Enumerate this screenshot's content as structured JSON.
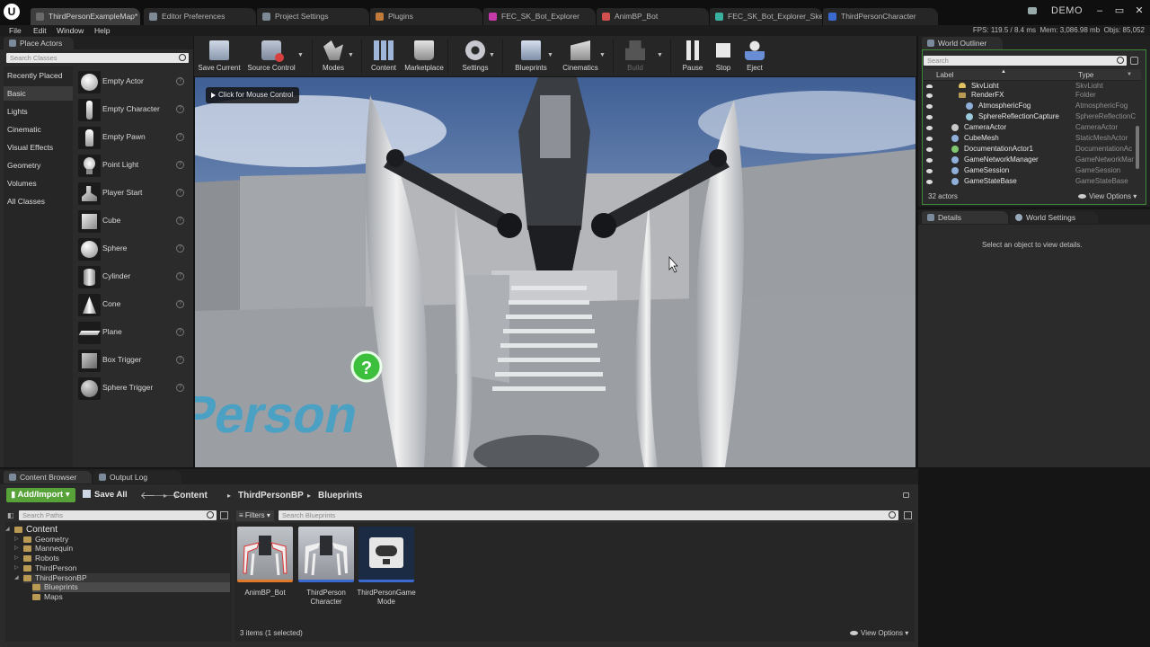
{
  "tabs": [
    {
      "label": "ThirdPersonExampleMap*",
      "active": true
    },
    {
      "label": "Editor Preferences"
    },
    {
      "label": "Project Settings"
    },
    {
      "label": "Plugins"
    },
    {
      "label": "FEC_SK_Bot_Explorer"
    },
    {
      "label": "AnimBP_Bot"
    },
    {
      "label": "FEC_SK_Bot_Explorer_Ske"
    },
    {
      "label": "ThirdPersonCharacter"
    }
  ],
  "app_badge": "DEMO",
  "menu": [
    "File",
    "Edit",
    "Window",
    "Help"
  ],
  "perf": {
    "fps_label": "FPS:",
    "fps": "119.5",
    "ms": "8.4 ms",
    "mem_label": "Mem:",
    "mem": "3,086.98 mb",
    "objs_label": "Objs:",
    "objs": "85,052"
  },
  "place_actors": {
    "tab": "Place Actors",
    "search_placeholder": "Search Classes",
    "categories": [
      "Recently Placed",
      "Basic",
      "Lights",
      "Cinematic",
      "Visual Effects",
      "Geometry",
      "Volumes",
      "All Classes"
    ],
    "selected_category": "Basic",
    "items": [
      "Empty Actor",
      "Empty Character",
      "Empty Pawn",
      "Point Light",
      "Player Start",
      "Cube",
      "Sphere",
      "Cylinder",
      "Cone",
      "Plane",
      "Box Trigger",
      "Sphere Trigger"
    ]
  },
  "toolbar": {
    "save": "Save Current",
    "source": "Source Control",
    "modes": "Modes",
    "content": "Content",
    "marketplace": "Marketplace",
    "settings": "Settings",
    "blueprints": "Blueprints",
    "cinematics": "Cinematics",
    "build": "Build",
    "pause": "Pause",
    "stop": "Stop",
    "eject": "Eject"
  },
  "viewport": {
    "hint": "Click for Mouse Control",
    "floor_text": "rd Person"
  },
  "outliner": {
    "tab": "World Outliner",
    "search_placeholder": "Search",
    "col_label": "Label",
    "col_type": "Type",
    "rows": [
      {
        "label": "SkyLight",
        "type": "SkyLight",
        "indent": 1,
        "color": "#e0c060"
      },
      {
        "label": "RenderFX",
        "type": "Folder",
        "indent": 1,
        "color": "#b89a55"
      },
      {
        "label": "AtmosphericFog",
        "type": "AtmosphericFog",
        "indent": 2,
        "color": "#8fb0d8"
      },
      {
        "label": "SphereReflectionCapture",
        "type": "SphereReflectionC",
        "indent": 2,
        "color": "#9acadb"
      },
      {
        "label": "CameraActor",
        "type": "CameraActor",
        "indent": 0,
        "color": "#c8c8c8"
      },
      {
        "label": "CubeMesh",
        "type": "StaticMeshActor",
        "indent": 0,
        "color": "#8fb0d8"
      },
      {
        "label": "DocumentationActor1",
        "type": "DocumentationAc",
        "indent": 0,
        "color": "#80c870"
      },
      {
        "label": "GameNetworkManager",
        "type": "GameNetworkMar",
        "indent": 0,
        "color": "#8fb0d8"
      },
      {
        "label": "GameSession",
        "type": "GameSession",
        "indent": 0,
        "color": "#8fb0d8"
      },
      {
        "label": "GameStateBase",
        "type": "GameStateBase",
        "indent": 0,
        "color": "#8fb0d8"
      }
    ],
    "count": "32 actors",
    "view_options": "View Options"
  },
  "details": {
    "tab": "Details",
    "tab2": "World Settings",
    "empty": "Select an object to view details."
  },
  "content_browser": {
    "tab": "Content Browser",
    "tab2": "Output Log",
    "add_import": "Add/Import",
    "save_all": "Save All",
    "breadcrumb": [
      "Content",
      "ThirdPersonBP",
      "Blueprints"
    ],
    "search_paths": "Search Paths",
    "filters": "Filters",
    "search_assets": "Search Blueprints",
    "tree": [
      {
        "label": "Content",
        "level": 0
      },
      {
        "label": "Geometry",
        "level": 1
      },
      {
        "label": "Mannequin",
        "level": 1
      },
      {
        "label": "Robots",
        "level": 1
      },
      {
        "label": "ThirdPerson",
        "level": 1
      },
      {
        "label": "ThirdPersonBP",
        "level": 1
      },
      {
        "label": "Blueprints",
        "level": 2
      },
      {
        "label": "Maps",
        "level": 2
      }
    ],
    "assets": [
      {
        "label": "AnimBP_Bot",
        "selected": true
      },
      {
        "label": "ThirdPerson Character"
      },
      {
        "label": "ThirdPersonGame Mode"
      }
    ],
    "status": "3 items (1 selected)",
    "view_options": "View Options"
  }
}
